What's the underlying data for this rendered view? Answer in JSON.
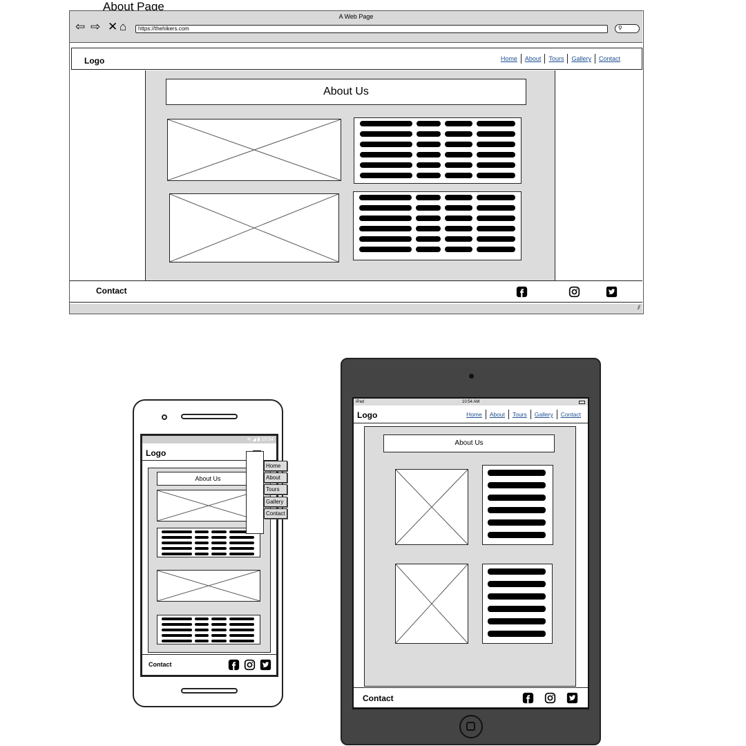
{
  "page_title": "About Page",
  "browser": {
    "window_title": "A Web Page",
    "url": "https://thehikers.com",
    "icons": [
      "back-arrow-icon",
      "forward-arrow-icon",
      "close-x-icon",
      "home-icon",
      "search-icon"
    ]
  },
  "site": {
    "logo": "Logo",
    "nav": [
      "Home",
      "About",
      "Tours",
      "Gallery",
      "Contact"
    ],
    "about_heading": "About Us",
    "footer_contact": "Contact",
    "social_icons": [
      "facebook-icon",
      "instagram-icon",
      "twitter-icon"
    ]
  },
  "phone": {
    "status_time": "10:54",
    "logo": "Logo",
    "about_heading": "About Us",
    "menu": [
      "Home",
      "About",
      "Tours",
      "Gallery",
      "Contact"
    ],
    "footer_contact": "Contact"
  },
  "tablet": {
    "status_left": "iPad",
    "status_time": "10:54 AM",
    "logo": "Logo",
    "nav": [
      "Home",
      "About",
      "Tours",
      "Gallery",
      "Contact"
    ],
    "about_heading": "About Us",
    "footer_contact": "Contact"
  },
  "colors": {
    "content_bg": "#dcdcdc",
    "link": "#1d4f91",
    "tablet_frame": "#444444"
  }
}
